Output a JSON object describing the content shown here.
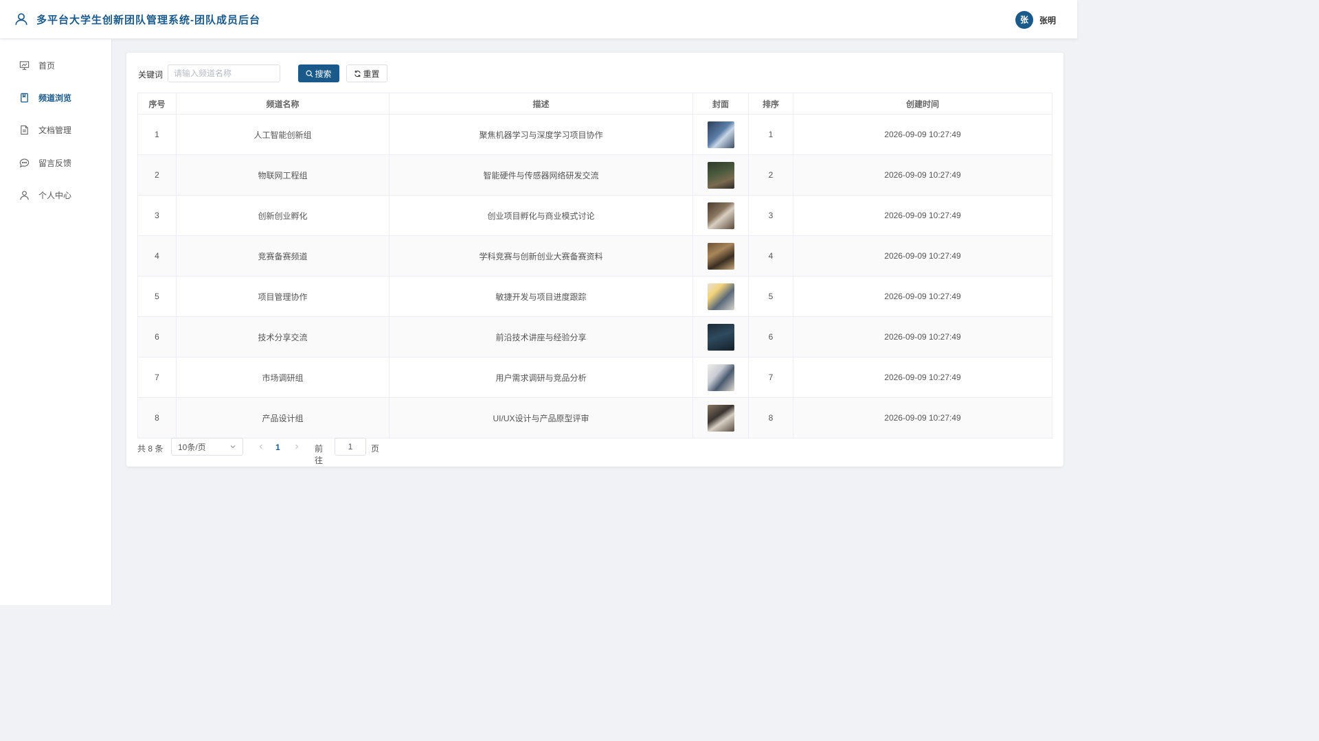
{
  "header": {
    "title": "多平台大学生创新团队管理系统-团队成员后台",
    "avatar_initial": "张",
    "username": "张明",
    "accent": "#1a5a8a"
  },
  "sidebar": {
    "items": [
      {
        "label": "首页",
        "icon": "presentation-icon",
        "active": false
      },
      {
        "label": "频道浏览",
        "icon": "book-icon",
        "active": true
      },
      {
        "label": "文档管理",
        "icon": "document-icon",
        "active": false
      },
      {
        "label": "留言反馈",
        "icon": "chat-bubble-icon",
        "active": false
      },
      {
        "label": "个人中心",
        "icon": "user-icon",
        "active": false
      }
    ]
  },
  "search": {
    "label": "关键词",
    "placeholder": "请输入频道名称",
    "value": "",
    "search_label": "搜索",
    "reset_label": "重置"
  },
  "table": {
    "columns": [
      "序号",
      "频道名称",
      "描述",
      "封面",
      "排序",
      "创建时间"
    ],
    "rows": [
      {
        "index": "1",
        "name": "人工智能创新组",
        "desc": "聚焦机器学习与深度学习项目协作",
        "cover": "cover-photo",
        "sort": "1",
        "created": "2026-09-09 10:27:49"
      },
      {
        "index": "2",
        "name": "物联网工程组",
        "desc": "智能硬件与传感器网络研发交流",
        "cover": "cover-photo",
        "sort": "2",
        "created": "2026-09-09 10:27:49"
      },
      {
        "index": "3",
        "name": "创新创业孵化",
        "desc": "创业项目孵化与商业模式讨论",
        "cover": "cover-photo",
        "sort": "3",
        "created": "2026-09-09 10:27:49"
      },
      {
        "index": "4",
        "name": "竞赛备赛频道",
        "desc": "学科竞赛与创新创业大赛备赛资料",
        "cover": "cover-photo",
        "sort": "4",
        "created": "2026-09-09 10:27:49"
      },
      {
        "index": "5",
        "name": "项目管理协作",
        "desc": "敏捷开发与项目进度跟踪",
        "cover": "cover-photo",
        "sort": "5",
        "created": "2026-09-09 10:27:49"
      },
      {
        "index": "6",
        "name": "技术分享交流",
        "desc": "前沿技术讲座与经验分享",
        "cover": "cover-photo",
        "sort": "6",
        "created": "2026-09-09 10:27:49"
      },
      {
        "index": "7",
        "name": "市场调研组",
        "desc": "用户需求调研与竞品分析",
        "cover": "cover-photo",
        "sort": "7",
        "created": "2026-09-09 10:27:49"
      },
      {
        "index": "8",
        "name": "产品设计组",
        "desc": "UI/UX设计与产品原型评审",
        "cover": "cover-photo",
        "sort": "8",
        "created": "2026-09-09 10:27:49"
      }
    ]
  },
  "pagination": {
    "total_text": "共 8 条",
    "page_size": "10条/页",
    "current_page": "1",
    "goto_label": "前往",
    "goto_value": "1",
    "page_unit": "页"
  }
}
